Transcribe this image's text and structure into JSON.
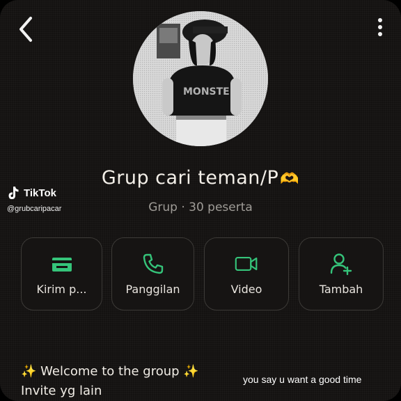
{
  "header": {
    "back_icon": "chevron-left-icon",
    "more_icon": "more-vertical-icon"
  },
  "group": {
    "name": "Grup cari teman/P",
    "name_emoji": "🫶",
    "subtitle": "Grup · 30 peserta"
  },
  "watermark": {
    "brand": "TikTok",
    "username": "@grubcaripacar"
  },
  "actions": [
    {
      "label": "Kirim p...",
      "icon": "payment-icon"
    },
    {
      "label": "Panggilan",
      "icon": "phone-icon"
    },
    {
      "label": "Video",
      "icon": "video-icon"
    },
    {
      "label": "Tambah",
      "icon": "add-user-icon"
    }
  ],
  "description": {
    "line1": "Welcome to the group",
    "line1_prefix": "✨",
    "line1_suffix": "✨",
    "line2": "Invite yg lain"
  },
  "caption": "you say u want a good time",
  "colors": {
    "background": "#141211",
    "accent_green": "#35c47a",
    "text": "#e9e5df",
    "subtext": "#9f9c97"
  }
}
